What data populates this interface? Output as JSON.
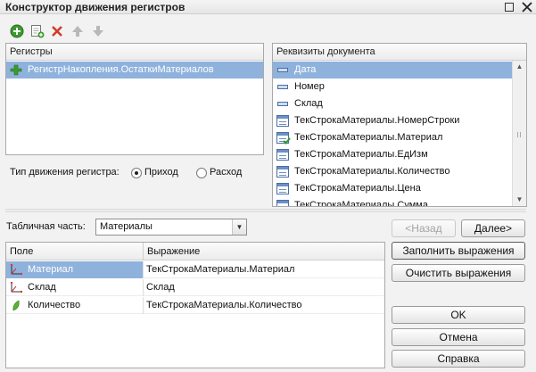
{
  "window": {
    "title": "Конструктор движения регистров"
  },
  "registers": {
    "header": "Регистры",
    "items": [
      {
        "label": "РегистрНакопления.ОстаткиМатериалов",
        "icon": "register-icon",
        "selected": true
      }
    ]
  },
  "movement": {
    "label": "Тип движения регистра:",
    "options": [
      "Приход",
      "Расход"
    ],
    "selected": "Приход"
  },
  "attributes": {
    "header": "Реквизиты документа",
    "items": [
      {
        "label": "Дата",
        "icon": "attribute-icon",
        "selected": true
      },
      {
        "label": "Номер",
        "icon": "attribute-icon"
      },
      {
        "label": "Склад",
        "icon": "attribute-icon"
      },
      {
        "label": "ТекСтрокаМатериалы.НомерСтроки",
        "icon": "tabular-attribute-icon"
      },
      {
        "label": "ТекСтрокаМатериалы.Материал",
        "icon": "tabular-attribute-used-icon"
      },
      {
        "label": "ТекСтрокаМатериалы.ЕдИзм",
        "icon": "tabular-attribute-icon"
      },
      {
        "label": "ТекСтрокаМатериалы.Количество",
        "icon": "tabular-attribute-icon"
      },
      {
        "label": "ТекСтрокаМатериалы.Цена",
        "icon": "tabular-attribute-icon"
      },
      {
        "label": "ТекСтрокаМатериалы.Сумма",
        "icon": "tabular-attribute-icon"
      }
    ]
  },
  "tabular": {
    "label": "Табличная часть:",
    "value": "Материалы"
  },
  "nav": {
    "back": "<Назад",
    "next": "Далее>"
  },
  "actions": {
    "fill": "Заполнить выражения",
    "clear": "Очистить выражения"
  },
  "grid": {
    "columns": [
      "Поле",
      "Выражение"
    ],
    "rows": [
      {
        "field": "Материал",
        "expr": "ТекСтрокаМатериалы.Материал",
        "icon": "dimension-icon"
      },
      {
        "field": "Склад",
        "expr": "Склад",
        "icon": "dimension-icon"
      },
      {
        "field": "Количество",
        "expr": "ТекСтрокаМатериалы.Количество",
        "icon": "resource-icon"
      }
    ]
  },
  "buttons": {
    "ok": "OK",
    "cancel": "Отмена",
    "help": "Справка"
  },
  "toolbar": [
    "add-icon",
    "copy-icon",
    "delete-icon",
    "move-up-icon",
    "move-down-icon"
  ],
  "colors": {
    "selection": "#8fb2dd",
    "background": "#f2f2f2"
  }
}
